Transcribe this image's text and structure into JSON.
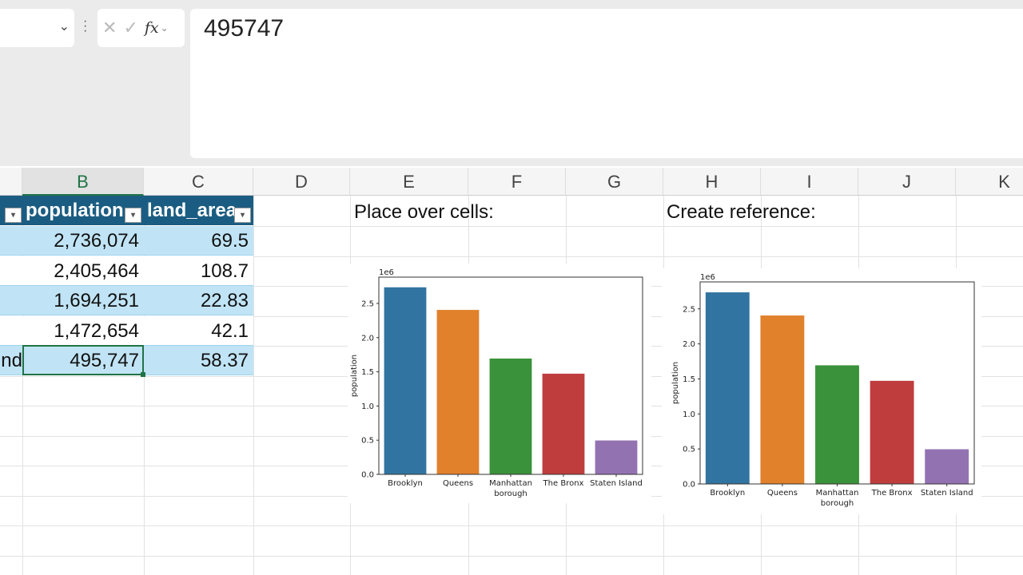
{
  "formula_bar": {
    "value": "495747",
    "fx_label": "fx"
  },
  "columns": [
    "B",
    "C",
    "D",
    "E",
    "F",
    "G",
    "H",
    "I",
    "J",
    "K"
  ],
  "selected_column": "B",
  "table": {
    "headers": [
      "population",
      "land_area"
    ],
    "rows": [
      {
        "a": "",
        "b": "2,736,074",
        "c": "69.5"
      },
      {
        "a": "",
        "b": "2,405,464",
        "c": "108.7"
      },
      {
        "a": "",
        "b": "1,694,251",
        "c": "22.83"
      },
      {
        "a": "",
        "b": "1,472,654",
        "c": "42.1"
      },
      {
        "a": "nd",
        "b": "495,747",
        "c": "58.37"
      }
    ]
  },
  "labels": {
    "place": "Place over cells:",
    "reference": "Create reference:"
  },
  "chart_data": [
    {
      "type": "bar",
      "title": "",
      "xlabel": "borough",
      "ylabel": "population",
      "offset_label": "1e6",
      "categories": [
        "Brooklyn",
        "Queens",
        "Manhattan",
        "The Bronx",
        "Staten Island"
      ],
      "values": [
        2736074,
        2405464,
        1694251,
        1472654,
        495747
      ],
      "colors": [
        "#3274a1",
        "#e1812c",
        "#3a923a",
        "#c03d3e",
        "#9372b2"
      ],
      "yticks": [
        "0.0",
        "0.5",
        "1.0",
        "1.5",
        "2.0",
        "2.5"
      ],
      "ylim": [
        0,
        2885000
      ],
      "grid": false
    },
    {
      "type": "bar",
      "title": "",
      "xlabel": "borough",
      "ylabel": "population",
      "offset_label": "1e6",
      "categories": [
        "Brooklyn",
        "Queens",
        "Manhattan",
        "The Bronx",
        "Staten Island"
      ],
      "values": [
        2736074,
        2405464,
        1694251,
        1472654,
        495747
      ],
      "colors": [
        "#3274a1",
        "#e1812c",
        "#3a923a",
        "#c03d3e",
        "#9372b2"
      ],
      "yticks": [
        "0.0",
        "0.5",
        "1.0",
        "1.5",
        "2.0",
        "2.5"
      ],
      "ylim": [
        0,
        2885000
      ],
      "grid": false
    }
  ]
}
